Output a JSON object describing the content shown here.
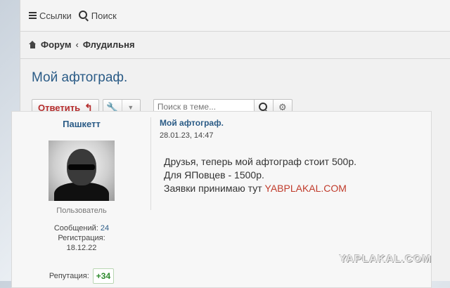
{
  "topbar": {
    "links_label": "Ссылки",
    "search_label": "Поиск"
  },
  "breadcrumb": {
    "forum": "Форум",
    "separator": "‹",
    "section": "Флудильня"
  },
  "topic": {
    "title": "Мой афтограф."
  },
  "toolbar": {
    "reply_label": "Ответить",
    "search_placeholder": "Поиск в теме..."
  },
  "post": {
    "author": {
      "name": "Пашкетт",
      "role": "Пользователь",
      "messages_label": "Сообщений:",
      "messages_value": "24",
      "registration_label": "Регистрация:",
      "registration_value": "18.12.22",
      "reputation_label": "Репутация:",
      "reputation_value": "+34"
    },
    "title": "Мой афтограф.",
    "date": "28.01.23, 14:47",
    "lines": [
      "Друзья, теперь мой афтограф стоит 500р.",
      "Для ЯПовцев - 1500р.",
      "Заявки принимаю тут "
    ],
    "link_text": "YABPLAKAL.COM"
  },
  "watermark": "YAPLAKAL.COM",
  "colors": {
    "title_blue": "#2a5b86",
    "reply_red": "#b52d2d",
    "link_red": "#c03b2b",
    "rep_green": "#2d8a2d"
  },
  "icons": [
    "menu-icon",
    "search-icon",
    "home-icon",
    "reply-arrow-icon",
    "wrench-icon",
    "caret-down-icon",
    "gear-icon"
  ]
}
